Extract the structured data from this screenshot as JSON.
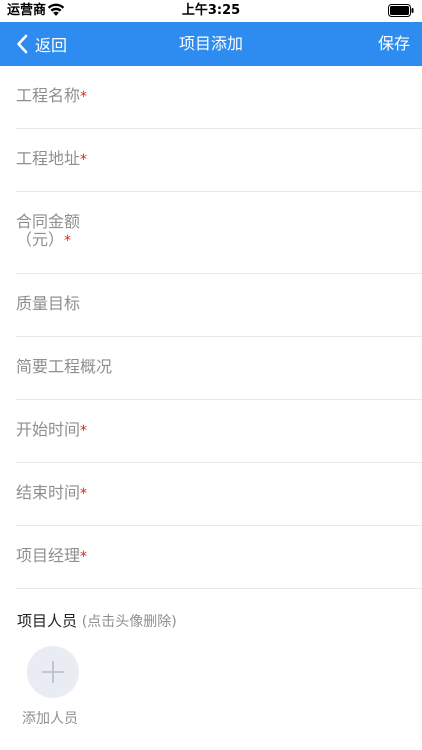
{
  "status_bar": {
    "carrier": "运营商",
    "time": "上午3:25",
    "wifi_icon": "wifi-icon",
    "battery_icon": "battery-icon"
  },
  "nav": {
    "back_label": "返回",
    "title": "项目添加",
    "save_label": "保存",
    "background": "#2e8cf0"
  },
  "form": {
    "fields": [
      {
        "label": "工程名称",
        "required_mark": "*"
      },
      {
        "label": "工程地址",
        "required_mark": "*"
      },
      {
        "label_line1": "合同金额",
        "label_line2": "（元）",
        "required_mark": "*"
      },
      {
        "label": "质量目标"
      },
      {
        "label": "简要工程概况"
      },
      {
        "label": "开始时间",
        "required_mark": "*"
      },
      {
        "label": "结束时间",
        "required_mark": "*"
      },
      {
        "label": "项目经理",
        "required_mark": "*"
      }
    ]
  },
  "people": {
    "title": "项目人员",
    "hint": "(点击头像删除)",
    "add_label": "添加人员"
  }
}
